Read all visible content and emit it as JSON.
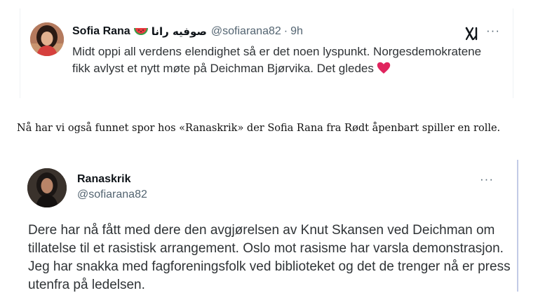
{
  "tweet1": {
    "name": "Sofia Rana",
    "name_emoji": "watermelon-emoji",
    "arabic_name": "صوفيه رانا",
    "handle": "@sofiarana82",
    "separator": "·",
    "time": "9h",
    "more": "···",
    "text": "Midt oppi all verdens elendighet så er det noen lyspunkt. Norgesdemokratene fikk avlyst et nytt møte på Deichman Bjørvika. Det gledes",
    "text_emoji": "red-heart-emoji",
    "logo_icon": "x-grok-icon"
  },
  "caption": "Nå har vi også funnet spor hos «Ranaskrik» der Sofia Rana fra Rødt åpenbart spiller en rolle.",
  "tweet2": {
    "name": "Ranaskrik",
    "handle": "@sofiarana82",
    "more": "···",
    "text": "Dere har nå fått med dere den avgjørelsen av Knut Skansen ved Deichman om tillatelse til et rasistisk arrangement. Oslo mot rasisme har varsla demonstrasjon. Jeg har snakka med fagforeningsfolk ved biblioteket og det de trenger nå er press utenfra på ledelsen."
  },
  "colors": {
    "text_primary": "#0f1419",
    "text_secondary": "#536471",
    "body_text": "#2f3336",
    "heart": "#e0245e",
    "side_rule": "#c2cbe6"
  }
}
